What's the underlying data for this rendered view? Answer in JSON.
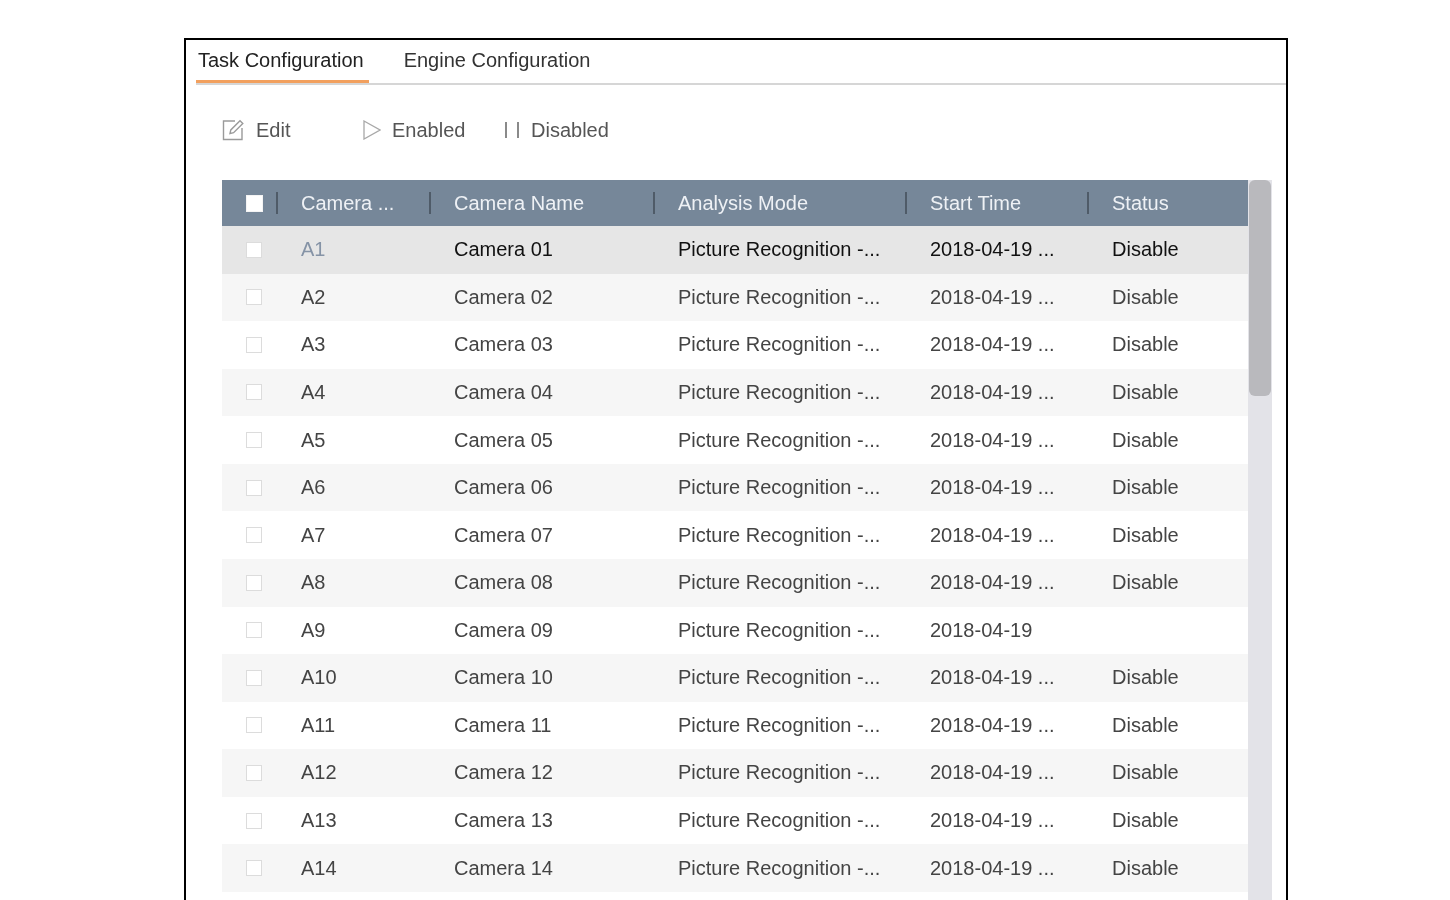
{
  "tabs": [
    {
      "label": "Task Configuration",
      "selected": true
    },
    {
      "label": "Engine Configuration",
      "selected": false
    }
  ],
  "toolbar": [
    {
      "kind": "edit",
      "label": "Edit"
    },
    {
      "kind": "enable",
      "label": "Enabled"
    },
    {
      "kind": "disable",
      "label": "Disabled"
    }
  ],
  "table": {
    "select_all": {
      "checked": false
    },
    "columns": [
      "Camera ...",
      "Camera Name",
      "Analysis Mode",
      "Start Time",
      "Status"
    ],
    "rows": [
      {
        "id": "A1",
        "name": "Camera 01",
        "mode": "Picture Recognition -...",
        "start_time": "2018-04-19 ...",
        "status": "Disable",
        "checked": false,
        "selected": true
      },
      {
        "id": "A2",
        "name": "Camera 02",
        "mode": "Picture Recognition -...",
        "start_time": "2018-04-19 ...",
        "status": "Disable",
        "checked": false,
        "selected": false
      },
      {
        "id": "A3",
        "name": "Camera 03",
        "mode": "Picture Recognition -...",
        "start_time": "2018-04-19 ...",
        "status": "Disable",
        "checked": false,
        "selected": false
      },
      {
        "id": "A4",
        "name": "Camera 04",
        "mode": "Picture Recognition -...",
        "start_time": "2018-04-19 ...",
        "status": "Disable",
        "checked": false,
        "selected": false
      },
      {
        "id": "A5",
        "name": "Camera 05",
        "mode": "Picture Recognition -...",
        "start_time": "2018-04-19 ...",
        "status": "Disable",
        "checked": false,
        "selected": false
      },
      {
        "id": "A6",
        "name": "Camera 06",
        "mode": "Picture Recognition -...",
        "start_time": "2018-04-19 ...",
        "status": "Disable",
        "checked": false,
        "selected": false
      },
      {
        "id": "A7",
        "name": "Camera 07",
        "mode": "Picture Recognition -...",
        "start_time": "2018-04-19 ...",
        "status": "Disable",
        "checked": false,
        "selected": false
      },
      {
        "id": "A8",
        "name": "Camera 08",
        "mode": "Picture Recognition -...",
        "start_time": "2018-04-19 ...",
        "status": "Disable",
        "checked": false,
        "selected": false
      },
      {
        "id": "A9",
        "name": "Camera 09",
        "mode": "Picture Recognition -...",
        "start_time": "2018-04-19",
        "checked": false,
        "selected": false
      },
      {
        "id": "A10",
        "name": "Camera 10",
        "mode": "Picture Recognition -...",
        "start_time": "2018-04-19 ...",
        "status": "Disable",
        "checked": false,
        "selected": false
      },
      {
        "id": "A11",
        "name": "Camera 11",
        "mode": "Picture Recognition -...",
        "start_time": "2018-04-19 ...",
        "status": "Disable",
        "checked": false,
        "selected": false
      },
      {
        "id": "A12",
        "name": "Camera 12",
        "mode": "Picture Recognition -...",
        "start_time": "2018-04-19 ...",
        "status": "Disable",
        "checked": false,
        "selected": false
      },
      {
        "id": "A13",
        "name": "Camera 13",
        "mode": "Picture Recognition -...",
        "start_time": "2018-04-19 ...",
        "status": "Disable",
        "checked": false,
        "selected": false
      },
      {
        "id": "A14",
        "name": "Camera 14",
        "mode": "Picture Recognition -...",
        "start_time": "2018-04-19 ...",
        "status": "Disable",
        "checked": false,
        "selected": false
      }
    ]
  }
}
